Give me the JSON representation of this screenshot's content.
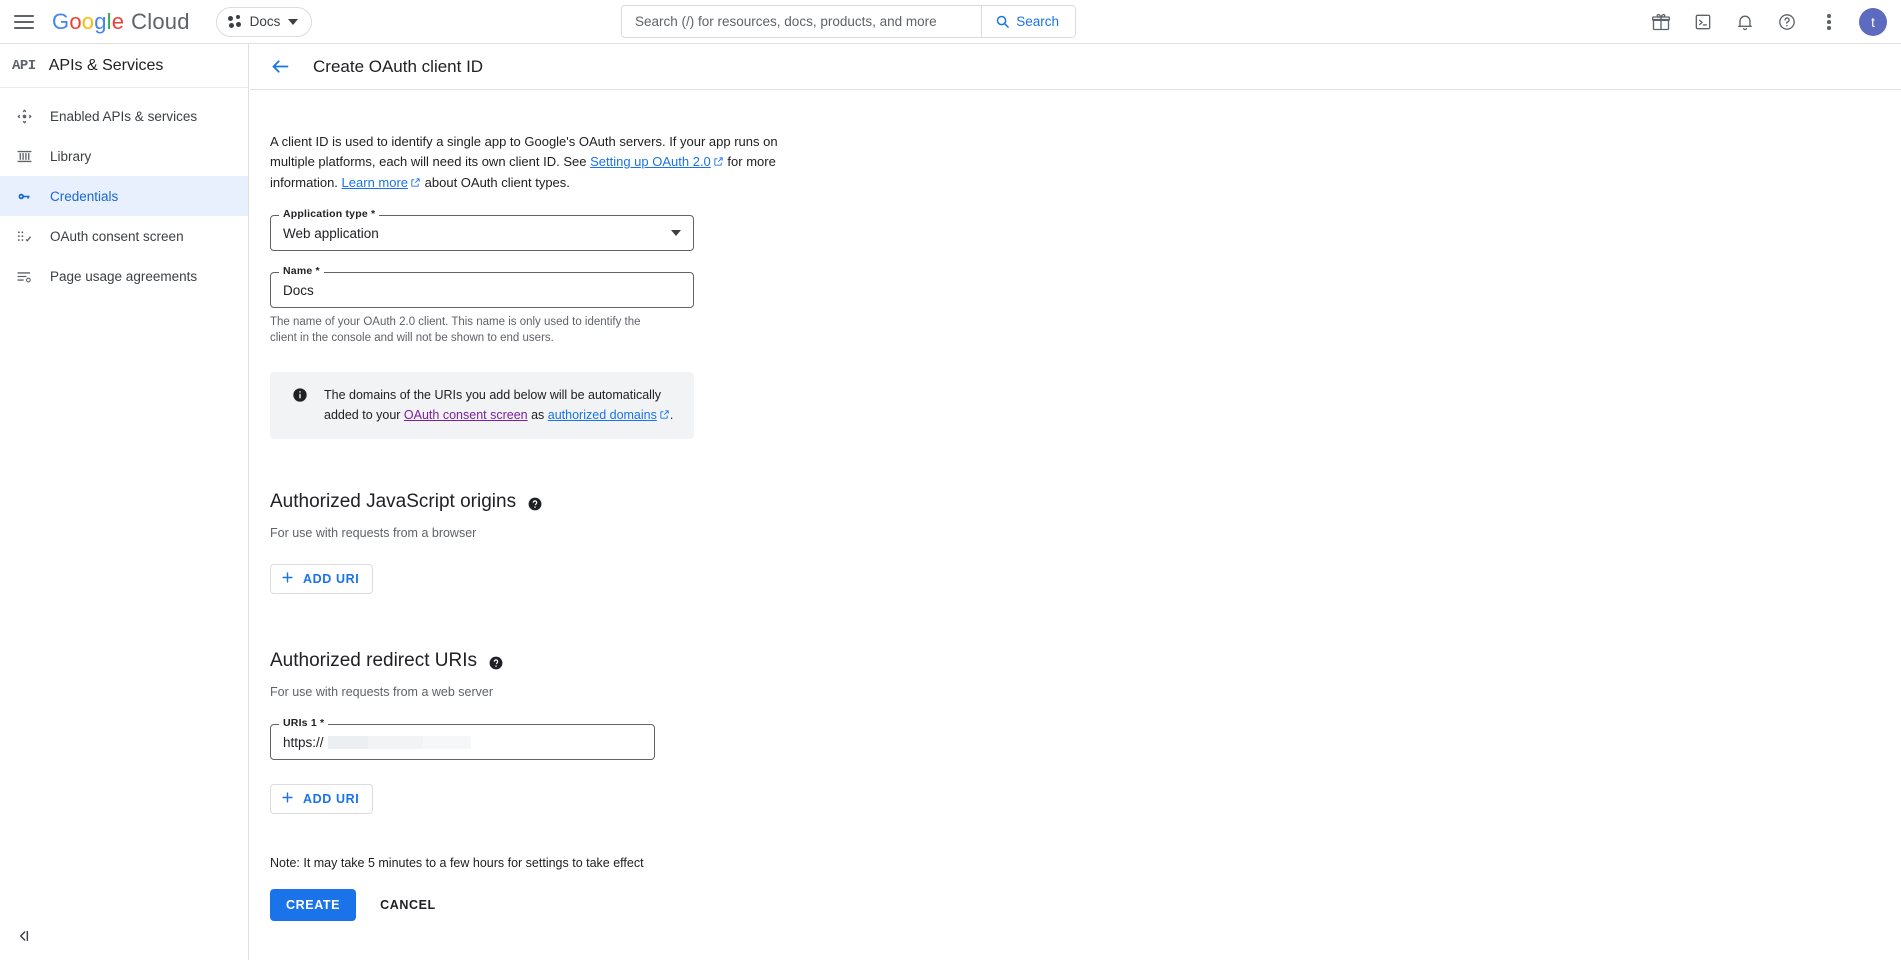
{
  "topbar": {
    "menu_icon": "hamburger-icon",
    "brand": {
      "google": "Google",
      "cloud": "Cloud"
    },
    "project_chip": {
      "label": "Docs",
      "icon": "project-dots-icon",
      "caret": "chevron-down-icon"
    },
    "search": {
      "placeholder": "Search (/) for resources, docs, products, and more",
      "value": "",
      "button_label": "Search",
      "button_icon": "search-icon"
    },
    "icons": [
      {
        "name": "gift-icon",
        "title": "Gifts"
      },
      {
        "name": "cloud-shell-icon",
        "title": "Activate Cloud Shell"
      },
      {
        "name": "notifications-bell-icon",
        "title": "Notifications"
      },
      {
        "name": "help-icon",
        "title": "Help"
      },
      {
        "name": "more-vert-icon",
        "title": "More options"
      }
    ],
    "avatar": {
      "initial": "t"
    }
  },
  "sidebar": {
    "product_logo": "API",
    "title": "APIs & Services",
    "items": [
      {
        "label": "Enabled APIs & services",
        "icon": "dashboard-icon",
        "active": false
      },
      {
        "label": "Library",
        "icon": "library-icon",
        "active": false
      },
      {
        "label": "Credentials",
        "icon": "key-icon",
        "active": true
      },
      {
        "label": "OAuth consent screen",
        "icon": "consent-screen-icon",
        "active": false
      },
      {
        "label": "Page usage agreements",
        "icon": "agreements-icon",
        "active": false
      }
    ],
    "collapse_icon": "collapse-panel-icon"
  },
  "page": {
    "back_icon": "back-arrow-icon",
    "title": "Create OAuth client ID"
  },
  "description": {
    "part1": "A client ID is used to identify a single app to Google's OAuth servers. If your app runs on multiple platforms, each will need its own client ID. See ",
    "link1": "Setting up OAuth 2.0",
    "part2": " for more information. ",
    "link2": "Learn more",
    "part3": " about OAuth client types."
  },
  "form": {
    "application_type": {
      "label": "Application type *",
      "value": "Web application"
    },
    "name": {
      "label": "Name *",
      "value": "Docs",
      "hint": "The name of your OAuth 2.0 client. This name is only used to identify the client in the console and will not be shown to end users."
    }
  },
  "info_banner": {
    "icon": "info-icon",
    "text_part1": "The domains of the URIs you add below will be automatically added to your ",
    "link1": "OAuth consent screen",
    "text_part2": " as ",
    "link2": "authorized domains",
    "text_part3": "."
  },
  "js_origins": {
    "title": "Authorized JavaScript origins",
    "help_icon": "help-circle-icon",
    "subtitle": "For use with requests from a browser",
    "add_button": {
      "label": "ADD URI",
      "icon": "plus-icon"
    }
  },
  "redirect_uris": {
    "title": "Authorized redirect URIs",
    "help_icon": "help-circle-icon",
    "subtitle": "For use with requests from a web server",
    "uri_field": {
      "label": "URIs 1 *",
      "value": "https://"
    },
    "add_button": {
      "label": "ADD URI",
      "icon": "plus-icon"
    }
  },
  "footer": {
    "note": "Note: It may take 5 minutes to a few hours for settings to take effect",
    "create_label": "CREATE",
    "cancel_label": "CANCEL"
  },
  "colors": {
    "accent_blue": "#1a73e8",
    "active_nav_bg": "#e8f0fe",
    "active_nav_text": "#1967d2",
    "visited_link": "#7b1fa2",
    "info_bg": "#f1f3f4",
    "avatar_bg": "#5c6bc0"
  }
}
